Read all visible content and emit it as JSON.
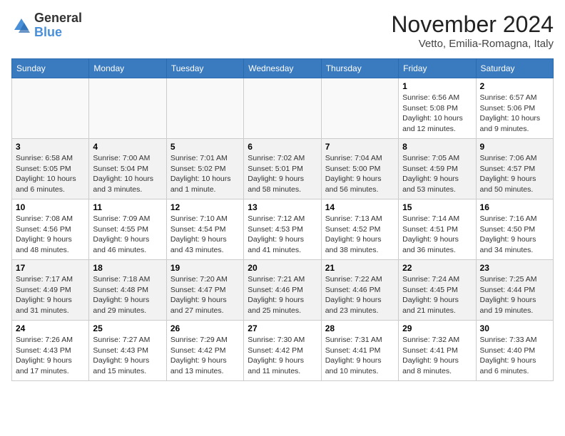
{
  "logo": {
    "line1": "General",
    "line2": "Blue"
  },
  "title": "November 2024",
  "location": "Vetto, Emilia-Romagna, Italy",
  "weekdays": [
    "Sunday",
    "Monday",
    "Tuesday",
    "Wednesday",
    "Thursday",
    "Friday",
    "Saturday"
  ],
  "weeks": [
    [
      {
        "day": "",
        "info": ""
      },
      {
        "day": "",
        "info": ""
      },
      {
        "day": "",
        "info": ""
      },
      {
        "day": "",
        "info": ""
      },
      {
        "day": "",
        "info": ""
      },
      {
        "day": "1",
        "info": "Sunrise: 6:56 AM\nSunset: 5:08 PM\nDaylight: 10 hours and 12 minutes."
      },
      {
        "day": "2",
        "info": "Sunrise: 6:57 AM\nSunset: 5:06 PM\nDaylight: 10 hours and 9 minutes."
      }
    ],
    [
      {
        "day": "3",
        "info": "Sunrise: 6:58 AM\nSunset: 5:05 PM\nDaylight: 10 hours and 6 minutes."
      },
      {
        "day": "4",
        "info": "Sunrise: 7:00 AM\nSunset: 5:04 PM\nDaylight: 10 hours and 3 minutes."
      },
      {
        "day": "5",
        "info": "Sunrise: 7:01 AM\nSunset: 5:02 PM\nDaylight: 10 hours and 1 minute."
      },
      {
        "day": "6",
        "info": "Sunrise: 7:02 AM\nSunset: 5:01 PM\nDaylight: 9 hours and 58 minutes."
      },
      {
        "day": "7",
        "info": "Sunrise: 7:04 AM\nSunset: 5:00 PM\nDaylight: 9 hours and 56 minutes."
      },
      {
        "day": "8",
        "info": "Sunrise: 7:05 AM\nSunset: 4:59 PM\nDaylight: 9 hours and 53 minutes."
      },
      {
        "day": "9",
        "info": "Sunrise: 7:06 AM\nSunset: 4:57 PM\nDaylight: 9 hours and 50 minutes."
      }
    ],
    [
      {
        "day": "10",
        "info": "Sunrise: 7:08 AM\nSunset: 4:56 PM\nDaylight: 9 hours and 48 minutes."
      },
      {
        "day": "11",
        "info": "Sunrise: 7:09 AM\nSunset: 4:55 PM\nDaylight: 9 hours and 46 minutes."
      },
      {
        "day": "12",
        "info": "Sunrise: 7:10 AM\nSunset: 4:54 PM\nDaylight: 9 hours and 43 minutes."
      },
      {
        "day": "13",
        "info": "Sunrise: 7:12 AM\nSunset: 4:53 PM\nDaylight: 9 hours and 41 minutes."
      },
      {
        "day": "14",
        "info": "Sunrise: 7:13 AM\nSunset: 4:52 PM\nDaylight: 9 hours and 38 minutes."
      },
      {
        "day": "15",
        "info": "Sunrise: 7:14 AM\nSunset: 4:51 PM\nDaylight: 9 hours and 36 minutes."
      },
      {
        "day": "16",
        "info": "Sunrise: 7:16 AM\nSunset: 4:50 PM\nDaylight: 9 hours and 34 minutes."
      }
    ],
    [
      {
        "day": "17",
        "info": "Sunrise: 7:17 AM\nSunset: 4:49 PM\nDaylight: 9 hours and 31 minutes."
      },
      {
        "day": "18",
        "info": "Sunrise: 7:18 AM\nSunset: 4:48 PM\nDaylight: 9 hours and 29 minutes."
      },
      {
        "day": "19",
        "info": "Sunrise: 7:20 AM\nSunset: 4:47 PM\nDaylight: 9 hours and 27 minutes."
      },
      {
        "day": "20",
        "info": "Sunrise: 7:21 AM\nSunset: 4:46 PM\nDaylight: 9 hours and 25 minutes."
      },
      {
        "day": "21",
        "info": "Sunrise: 7:22 AM\nSunset: 4:46 PM\nDaylight: 9 hours and 23 minutes."
      },
      {
        "day": "22",
        "info": "Sunrise: 7:24 AM\nSunset: 4:45 PM\nDaylight: 9 hours and 21 minutes."
      },
      {
        "day": "23",
        "info": "Sunrise: 7:25 AM\nSunset: 4:44 PM\nDaylight: 9 hours and 19 minutes."
      }
    ],
    [
      {
        "day": "24",
        "info": "Sunrise: 7:26 AM\nSunset: 4:43 PM\nDaylight: 9 hours and 17 minutes."
      },
      {
        "day": "25",
        "info": "Sunrise: 7:27 AM\nSunset: 4:43 PM\nDaylight: 9 hours and 15 minutes."
      },
      {
        "day": "26",
        "info": "Sunrise: 7:29 AM\nSunset: 4:42 PM\nDaylight: 9 hours and 13 minutes."
      },
      {
        "day": "27",
        "info": "Sunrise: 7:30 AM\nSunset: 4:42 PM\nDaylight: 9 hours and 11 minutes."
      },
      {
        "day": "28",
        "info": "Sunrise: 7:31 AM\nSunset: 4:41 PM\nDaylight: 9 hours and 10 minutes."
      },
      {
        "day": "29",
        "info": "Sunrise: 7:32 AM\nSunset: 4:41 PM\nDaylight: 9 hours and 8 minutes."
      },
      {
        "day": "30",
        "info": "Sunrise: 7:33 AM\nSunset: 4:40 PM\nDaylight: 9 hours and 6 minutes."
      }
    ]
  ]
}
